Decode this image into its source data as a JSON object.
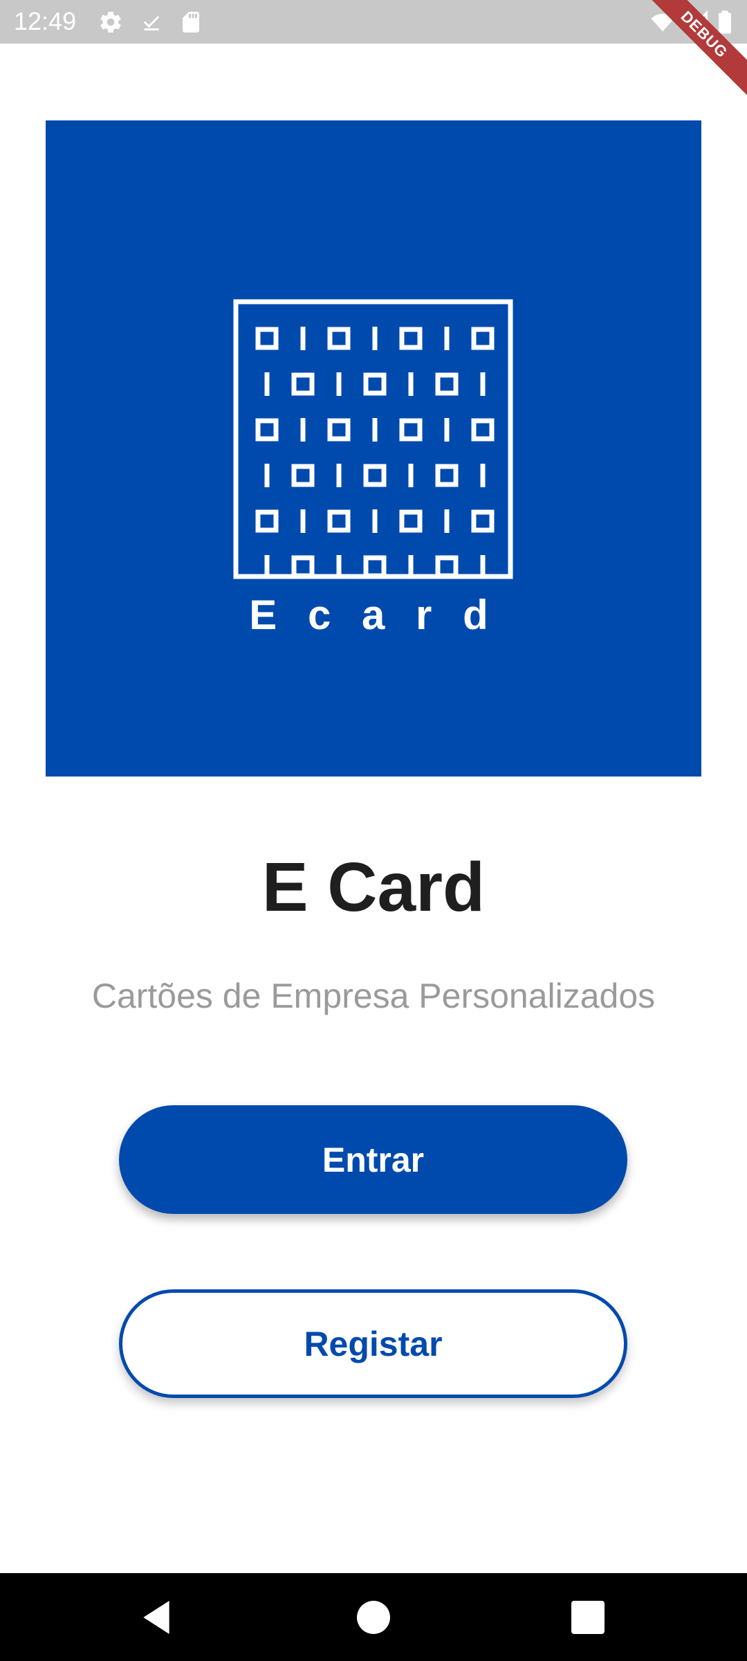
{
  "status_bar": {
    "time": "12:49",
    "icons": [
      "settings-icon",
      "download-done-icon",
      "sd-card-icon",
      "wifi-icon",
      "signal-icon",
      "battery-icon"
    ]
  },
  "debug_banner": "DEBUG",
  "logo": {
    "text": "E c a r d",
    "background_color": "#004aad"
  },
  "app_title": "E Card",
  "subtitle": "Cartões de Empresa Personalizados",
  "buttons": {
    "login_label": "Entrar",
    "register_label": "Registar"
  },
  "nav_bar": {
    "icons": [
      "back-icon",
      "home-icon",
      "recents-icon"
    ]
  },
  "colors": {
    "brand_blue": "#004aad",
    "title": "#1f1f1f",
    "subtitle": "#9a9a9a"
  }
}
